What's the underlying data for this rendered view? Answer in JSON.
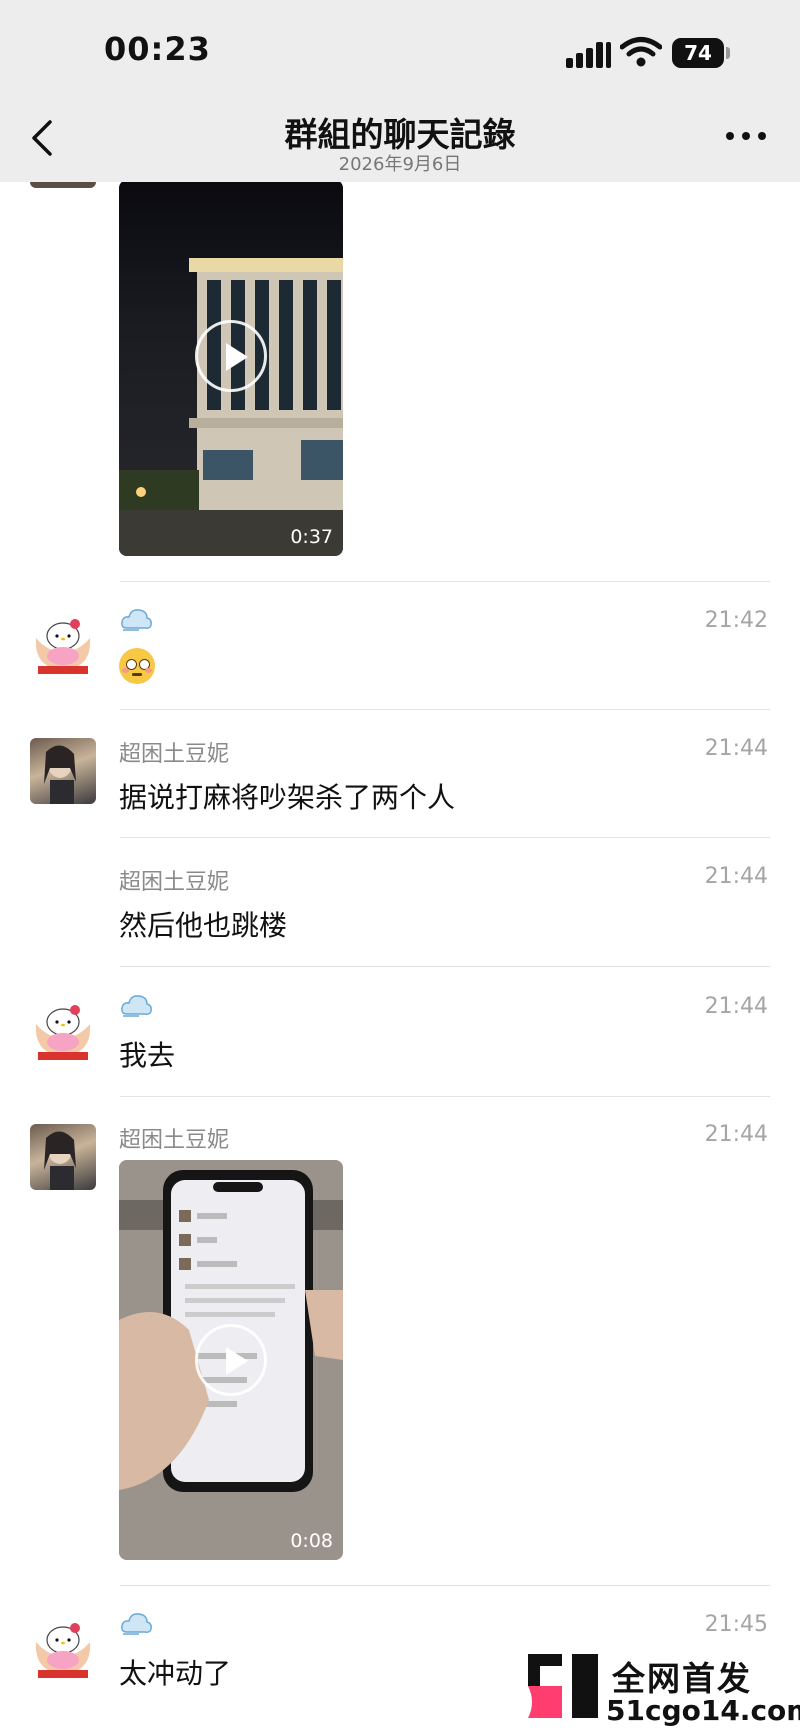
{
  "status_bar": {
    "time": "00:23",
    "battery": "74"
  },
  "nav": {
    "title": "群組的聊天記錄",
    "subtitle": "2026年9月6日"
  },
  "messages": [
    {
      "type": "video",
      "duration": "0:37"
    },
    {
      "sender_icon": "cloud-icon",
      "time": "21:42",
      "emoji": "flushed-face"
    },
    {
      "sender": "超困土豆妮",
      "time": "21:44",
      "text": "据说打麻将吵架杀了两个人"
    },
    {
      "sender": "超困土豆妮",
      "time": "21:44",
      "text": "然后他也跳楼"
    },
    {
      "sender_icon": "cloud-icon",
      "time": "21:44",
      "text": "我去"
    },
    {
      "sender": "超困土豆妮",
      "time": "21:44",
      "type": "video",
      "duration": "0:08"
    },
    {
      "sender_icon": "cloud-icon",
      "time": "21:45",
      "text": "太冲动了"
    }
  ],
  "watermark": {
    "line1": "全网首发",
    "line2": "51cgo14.com"
  }
}
